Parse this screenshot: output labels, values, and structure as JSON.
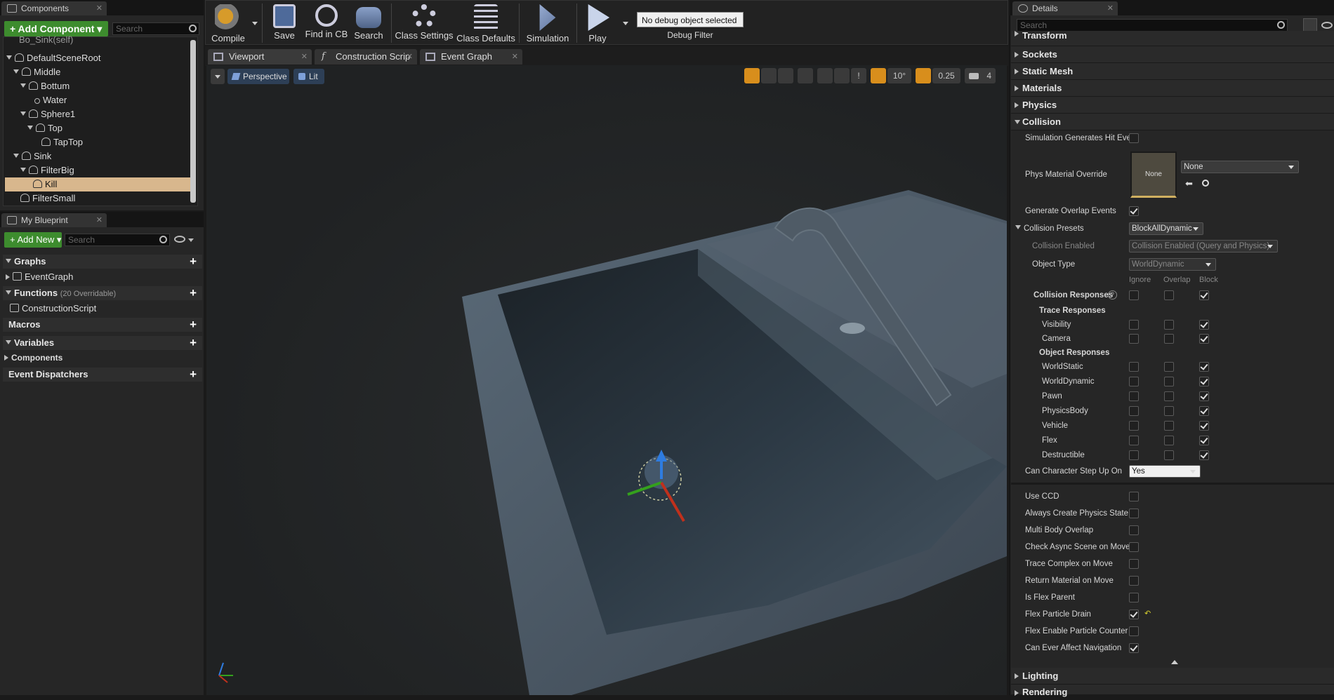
{
  "components": {
    "tab_label": "Components",
    "add_label": "+ Add Component ▾",
    "search_placeholder": "Search",
    "partial_top": "Bo_Sink(self)",
    "tree": [
      {
        "label": "DefaultSceneRoot"
      },
      {
        "label": "Middle"
      },
      {
        "label": "Bottum"
      },
      {
        "label": "Water"
      },
      {
        "label": "Sphere1"
      },
      {
        "label": "Top"
      },
      {
        "label": "TapTop"
      },
      {
        "label": "Sink"
      },
      {
        "label": "FilterBig"
      },
      {
        "label": "Kill"
      },
      {
        "label": "FilterSmall"
      }
    ]
  },
  "blueprint": {
    "tab_label": "My Blueprint",
    "add_label": "+ Add New ▾",
    "search_placeholder": "Search",
    "graphs_label": "Graphs",
    "eventgraph_label": "EventGraph",
    "functions_label": "Functions",
    "functions_note": "(20 Overridable)",
    "constructionscript_label": "ConstructionScript",
    "macros_label": "Macros",
    "variables_label": "Variables",
    "components_label": "Components",
    "dispatchers_label": "Event Dispatchers"
  },
  "toolbar": {
    "compile": "Compile",
    "save": "Save",
    "find_in_cb": "Find in CB",
    "search": "Search",
    "class_settings": "Class Settings",
    "class_defaults": "Class Defaults",
    "simulation": "Simulation",
    "play": "Play",
    "debug_object": "No debug object selected",
    "debug_filter": "Debug Filter"
  },
  "editor_tabs": {
    "viewport": "Viewport",
    "construction": "Construction Scrip",
    "event_graph": "Event Graph"
  },
  "viewport": {
    "perspective": "Perspective",
    "lit": "Lit",
    "angle_snap": "10°",
    "scale_snap": "0.25",
    "camera_speed": "4"
  },
  "details": {
    "tab_label": "Details",
    "search_placeholder": "Search",
    "sections": {
      "transform": "Transform",
      "sockets": "Sockets",
      "static_mesh": "Static Mesh",
      "materials": "Materials",
      "physics": "Physics",
      "collision": "Collision",
      "lighting": "Lighting",
      "rendering": "Rendering"
    },
    "sim_hit": "Simulation Generates Hit Eve",
    "phys_material": "Phys Material Override",
    "thumb_none": "None",
    "phys_material_value": "None",
    "overlap_events": "Generate Overlap Events",
    "collision_presets": "Collision Presets",
    "collision_presets_value": "BlockAllDynamic",
    "collision_enabled": "Collision Enabled",
    "collision_enabled_value": "Collision Enabled (Query and Physics)",
    "object_type": "Object Type",
    "object_type_value": "WorldDynamic",
    "col_ignore": "Ignore",
    "col_overlap": "Overlap",
    "col_block": "Block",
    "collision_responses": "Collision Responses",
    "trace_responses": "Trace Responses",
    "object_responses": "Object Responses",
    "responses": [
      {
        "name": "Visibility"
      },
      {
        "name": "Camera"
      },
      {
        "name": "WorldStatic"
      },
      {
        "name": "WorldDynamic"
      },
      {
        "name": "Pawn"
      },
      {
        "name": "PhysicsBody"
      },
      {
        "name": "Vehicle"
      },
      {
        "name": "Flex"
      },
      {
        "name": "Destructible"
      }
    ],
    "step_up": "Can Character Step Up On",
    "step_up_value": "Yes",
    "flags": [
      {
        "label": "Use CCD",
        "checked": false
      },
      {
        "label": "Always Create Physics State",
        "checked": false
      },
      {
        "label": "Multi Body Overlap",
        "checked": false
      },
      {
        "label": "Check Async Scene on Move",
        "checked": false
      },
      {
        "label": "Trace Complex on Move",
        "checked": false
      },
      {
        "label": "Return Material on Move",
        "checked": false
      },
      {
        "label": "Is Flex Parent",
        "checked": false
      },
      {
        "label": "Flex Particle Drain",
        "checked": true
      },
      {
        "label": "Flex Enable Particle Counter",
        "checked": false
      },
      {
        "label": "Can Ever Affect Navigation",
        "checked": true
      }
    ]
  },
  "colors": {
    "accent_green": "#3d8c2e",
    "selection": "#d8b78d",
    "background": "#262626"
  }
}
